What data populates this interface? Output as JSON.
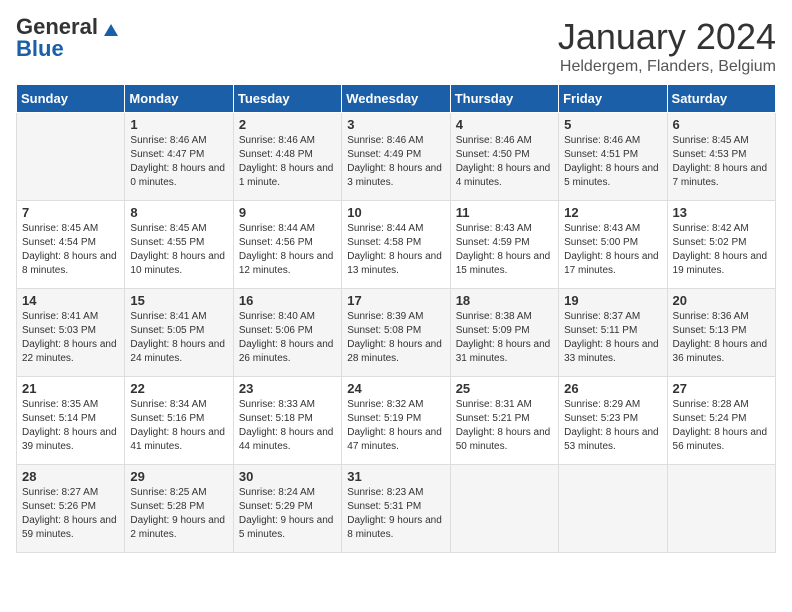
{
  "logo": {
    "general": "General",
    "blue": "Blue"
  },
  "header": {
    "title": "January 2024",
    "subtitle": "Heldergem, Flanders, Belgium"
  },
  "days_of_week": [
    "Sunday",
    "Monday",
    "Tuesday",
    "Wednesday",
    "Thursday",
    "Friday",
    "Saturday"
  ],
  "weeks": [
    [
      {
        "day": "",
        "sunrise": "",
        "sunset": "",
        "daylight": ""
      },
      {
        "day": "1",
        "sunrise": "Sunrise: 8:46 AM",
        "sunset": "Sunset: 4:47 PM",
        "daylight": "Daylight: 8 hours and 0 minutes."
      },
      {
        "day": "2",
        "sunrise": "Sunrise: 8:46 AM",
        "sunset": "Sunset: 4:48 PM",
        "daylight": "Daylight: 8 hours and 1 minute."
      },
      {
        "day": "3",
        "sunrise": "Sunrise: 8:46 AM",
        "sunset": "Sunset: 4:49 PM",
        "daylight": "Daylight: 8 hours and 3 minutes."
      },
      {
        "day": "4",
        "sunrise": "Sunrise: 8:46 AM",
        "sunset": "Sunset: 4:50 PM",
        "daylight": "Daylight: 8 hours and 4 minutes."
      },
      {
        "day": "5",
        "sunrise": "Sunrise: 8:46 AM",
        "sunset": "Sunset: 4:51 PM",
        "daylight": "Daylight: 8 hours and 5 minutes."
      },
      {
        "day": "6",
        "sunrise": "Sunrise: 8:45 AM",
        "sunset": "Sunset: 4:53 PM",
        "daylight": "Daylight: 8 hours and 7 minutes."
      }
    ],
    [
      {
        "day": "7",
        "sunrise": "Sunrise: 8:45 AM",
        "sunset": "Sunset: 4:54 PM",
        "daylight": "Daylight: 8 hours and 8 minutes."
      },
      {
        "day": "8",
        "sunrise": "Sunrise: 8:45 AM",
        "sunset": "Sunset: 4:55 PM",
        "daylight": "Daylight: 8 hours and 10 minutes."
      },
      {
        "day": "9",
        "sunrise": "Sunrise: 8:44 AM",
        "sunset": "Sunset: 4:56 PM",
        "daylight": "Daylight: 8 hours and 12 minutes."
      },
      {
        "day": "10",
        "sunrise": "Sunrise: 8:44 AM",
        "sunset": "Sunset: 4:58 PM",
        "daylight": "Daylight: 8 hours and 13 minutes."
      },
      {
        "day": "11",
        "sunrise": "Sunrise: 8:43 AM",
        "sunset": "Sunset: 4:59 PM",
        "daylight": "Daylight: 8 hours and 15 minutes."
      },
      {
        "day": "12",
        "sunrise": "Sunrise: 8:43 AM",
        "sunset": "Sunset: 5:00 PM",
        "daylight": "Daylight: 8 hours and 17 minutes."
      },
      {
        "day": "13",
        "sunrise": "Sunrise: 8:42 AM",
        "sunset": "Sunset: 5:02 PM",
        "daylight": "Daylight: 8 hours and 19 minutes."
      }
    ],
    [
      {
        "day": "14",
        "sunrise": "Sunrise: 8:41 AM",
        "sunset": "Sunset: 5:03 PM",
        "daylight": "Daylight: 8 hours and 22 minutes."
      },
      {
        "day": "15",
        "sunrise": "Sunrise: 8:41 AM",
        "sunset": "Sunset: 5:05 PM",
        "daylight": "Daylight: 8 hours and 24 minutes."
      },
      {
        "day": "16",
        "sunrise": "Sunrise: 8:40 AM",
        "sunset": "Sunset: 5:06 PM",
        "daylight": "Daylight: 8 hours and 26 minutes."
      },
      {
        "day": "17",
        "sunrise": "Sunrise: 8:39 AM",
        "sunset": "Sunset: 5:08 PM",
        "daylight": "Daylight: 8 hours and 28 minutes."
      },
      {
        "day": "18",
        "sunrise": "Sunrise: 8:38 AM",
        "sunset": "Sunset: 5:09 PM",
        "daylight": "Daylight: 8 hours and 31 minutes."
      },
      {
        "day": "19",
        "sunrise": "Sunrise: 8:37 AM",
        "sunset": "Sunset: 5:11 PM",
        "daylight": "Daylight: 8 hours and 33 minutes."
      },
      {
        "day": "20",
        "sunrise": "Sunrise: 8:36 AM",
        "sunset": "Sunset: 5:13 PM",
        "daylight": "Daylight: 8 hours and 36 minutes."
      }
    ],
    [
      {
        "day": "21",
        "sunrise": "Sunrise: 8:35 AM",
        "sunset": "Sunset: 5:14 PM",
        "daylight": "Daylight: 8 hours and 39 minutes."
      },
      {
        "day": "22",
        "sunrise": "Sunrise: 8:34 AM",
        "sunset": "Sunset: 5:16 PM",
        "daylight": "Daylight: 8 hours and 41 minutes."
      },
      {
        "day": "23",
        "sunrise": "Sunrise: 8:33 AM",
        "sunset": "Sunset: 5:18 PM",
        "daylight": "Daylight: 8 hours and 44 minutes."
      },
      {
        "day": "24",
        "sunrise": "Sunrise: 8:32 AM",
        "sunset": "Sunset: 5:19 PM",
        "daylight": "Daylight: 8 hours and 47 minutes."
      },
      {
        "day": "25",
        "sunrise": "Sunrise: 8:31 AM",
        "sunset": "Sunset: 5:21 PM",
        "daylight": "Daylight: 8 hours and 50 minutes."
      },
      {
        "day": "26",
        "sunrise": "Sunrise: 8:29 AM",
        "sunset": "Sunset: 5:23 PM",
        "daylight": "Daylight: 8 hours and 53 minutes."
      },
      {
        "day": "27",
        "sunrise": "Sunrise: 8:28 AM",
        "sunset": "Sunset: 5:24 PM",
        "daylight": "Daylight: 8 hours and 56 minutes."
      }
    ],
    [
      {
        "day": "28",
        "sunrise": "Sunrise: 8:27 AM",
        "sunset": "Sunset: 5:26 PM",
        "daylight": "Daylight: 8 hours and 59 minutes."
      },
      {
        "day": "29",
        "sunrise": "Sunrise: 8:25 AM",
        "sunset": "Sunset: 5:28 PM",
        "daylight": "Daylight: 9 hours and 2 minutes."
      },
      {
        "day": "30",
        "sunrise": "Sunrise: 8:24 AM",
        "sunset": "Sunset: 5:29 PM",
        "daylight": "Daylight: 9 hours and 5 minutes."
      },
      {
        "day": "31",
        "sunrise": "Sunrise: 8:23 AM",
        "sunset": "Sunset: 5:31 PM",
        "daylight": "Daylight: 9 hours and 8 minutes."
      },
      {
        "day": "",
        "sunrise": "",
        "sunset": "",
        "daylight": ""
      },
      {
        "day": "",
        "sunrise": "",
        "sunset": "",
        "daylight": ""
      },
      {
        "day": "",
        "sunrise": "",
        "sunset": "",
        "daylight": ""
      }
    ]
  ]
}
